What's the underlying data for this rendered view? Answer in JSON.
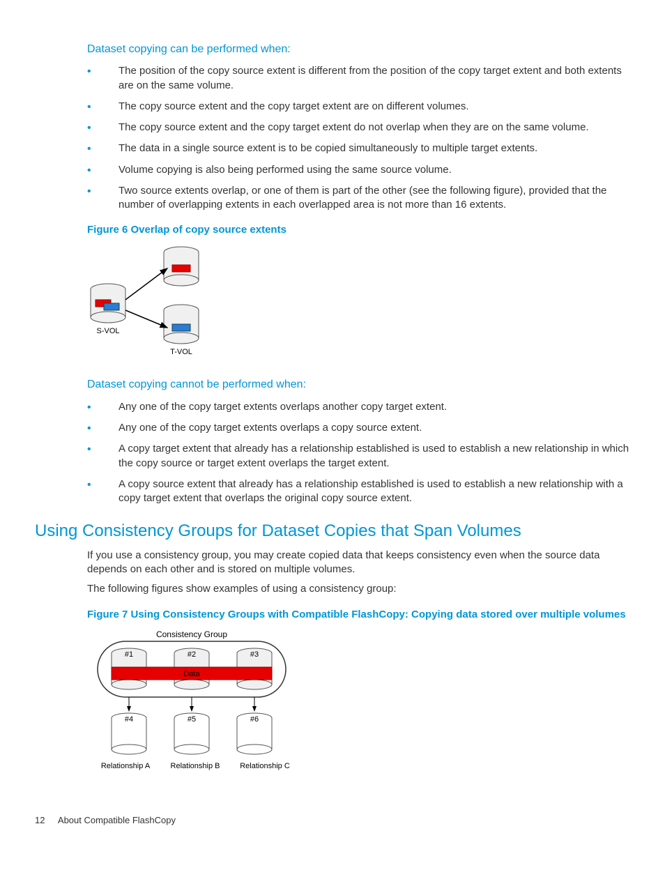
{
  "sections": {
    "sub1": "Dataset copying can be performed when:",
    "sub2": "Dataset copying cannot be performed when:",
    "h2": "Using Consistency Groups for Dataset Copies that Span Volumes"
  },
  "bullets_can": [
    "The position of the copy source extent is different from the position of the copy target extent and both extents are on the same volume.",
    "The copy source extent and the copy target extent are on different volumes.",
    "The copy source extent and the copy target extent do not overlap when they are on the same volume.",
    "The data in a single source extent is to be copied simultaneously to multiple target extents.",
    "Volume copying is also being performed using the same source volume.",
    "Two source extents overlap, or one of them is part of the other (see the following figure), provided that the number of overlapping extents in each overlapped area is not more than 16 extents."
  ],
  "bullets_cannot": [
    "Any one of the copy target extents overlaps another copy target extent.",
    "Any one of the copy target extents overlaps a copy source extent.",
    "A copy target extent that already has a relationship established is used to establish a new relationship in which the copy source or target extent overlaps the target extent.",
    "A copy source extent that already has a relationship established is used to establish a new relationship with a copy target extent that overlaps the original copy source extent."
  ],
  "figure6_caption": "Figure 6 Overlap of copy source extents",
  "figure7_caption": "Figure 7 Using Consistency Groups with Compatible FlashCopy: Copying data stored over multiple volumes",
  "paragraphs": {
    "p1": "If you use a consistency group, you may create copied data that keeps consistency even when the source data depends on each other and is stored on multiple volumes.",
    "p2": "The following figures show examples of using a consistency group:"
  },
  "fig6": {
    "svol": "S-VOL",
    "tvol": "T-VOL"
  },
  "fig7": {
    "cg": "Consistency Group",
    "c1": "#1",
    "c2": "#2",
    "c3": "#3",
    "c4": "#4",
    "c5": "#5",
    "c6": "#6",
    "data": "Data",
    "ra": "Relationship A",
    "rb": "Relationship B",
    "rc": "Relationship C"
  },
  "footer": {
    "page": "12",
    "chapter": "About Compatible FlashCopy"
  }
}
